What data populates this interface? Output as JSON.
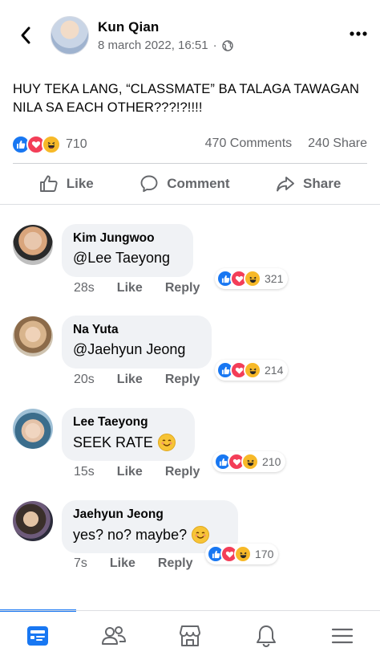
{
  "post": {
    "author": "Kun Qian",
    "timestamp": "8 march 2022, 16:51",
    "separator": "·",
    "text": "HUY TEKA LANG, “CLASSMATE” BA TALAGA TAWAGAN NILA SA EACH OTHER???!?!!!!",
    "reaction_count": "710",
    "comments_count": "470 Comments",
    "shares_count": "240 Share"
  },
  "actions": {
    "like": "Like",
    "comment": "Comment",
    "share": "Share"
  },
  "comments": [
    {
      "name": "Kim Jungwoo",
      "text": "@Lee Taeyong",
      "time": "28s",
      "like": "Like",
      "reply": "Reply",
      "reactions": "321"
    },
    {
      "name": "Na Yuta",
      "text": "@Jaehyun Jeong",
      "time": "20s",
      "like": "Like",
      "reply": "Reply",
      "reactions": "214"
    },
    {
      "name": "Lee Taeyong",
      "text": "SEEK RATE",
      "time": "15s",
      "like": "Like",
      "reply": "Reply",
      "reactions": "210"
    },
    {
      "name": "Jaehyun Jeong",
      "text": "yes? no? maybe?",
      "time": "7s",
      "like": "Like",
      "reply": "Reply",
      "reactions": "170"
    }
  ],
  "icons": {
    "back": "chevron-left-icon",
    "more": "more-options-icon",
    "privacy": "globe-icon",
    "reactions": [
      "like-reaction-icon",
      "love-reaction-icon",
      "haha-reaction-icon"
    ],
    "emoji": "smiling-face-icon",
    "nav": [
      "feed-icon",
      "friends-icon",
      "marketplace-icon",
      "notifications-icon",
      "menu-icon"
    ]
  },
  "colors": {
    "brand": "#1877f2",
    "love": "#f33e58",
    "haha": "#f7b928",
    "secondary_text": "#65676b",
    "bubble": "#f0f2f5"
  }
}
